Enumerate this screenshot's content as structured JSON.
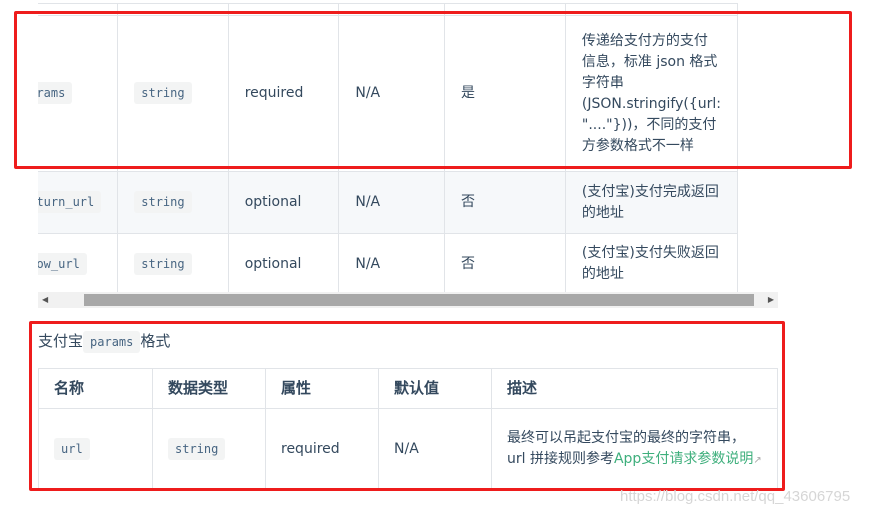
{
  "top_table": {
    "rows": [
      {
        "name": "params",
        "type": "string",
        "attr": "required",
        "default": "N/A",
        "required": "是",
        "desc": "传递给支付方的支付信息，标准 json 格式字符串 (JSON.stringify({url: \"....\"}))，不同的支付方参数格式不一样"
      },
      {
        "name": "return_url",
        "type": "string",
        "attr": "optional",
        "default": "N/A",
        "required": "否",
        "desc": "(支付宝)支付完成返回的地址"
      },
      {
        "name": "show_url",
        "type": "string",
        "attr": "optional",
        "default": "N/A",
        "required": "否",
        "desc": "(支付宝)支付失败返回的地址"
      }
    ]
  },
  "section": {
    "prefix": "支付宝",
    "code": "params",
    "suffix": "格式"
  },
  "bottom_table": {
    "headers": [
      "名称",
      "数据类型",
      "属性",
      "默认值",
      "描述"
    ],
    "rows": [
      {
        "name": "url",
        "type": "string",
        "attr": "required",
        "default": "N/A",
        "desc": "最终可以吊起支付宝的最终的字符串，url 拼接规则参考",
        "link": "App支付请求参数说明"
      }
    ]
  },
  "watermark": "https://blog.csdn.net/qq_43606795",
  "colors": {
    "highlight": "#ee1c1c",
    "link": "#3eaf7c"
  }
}
